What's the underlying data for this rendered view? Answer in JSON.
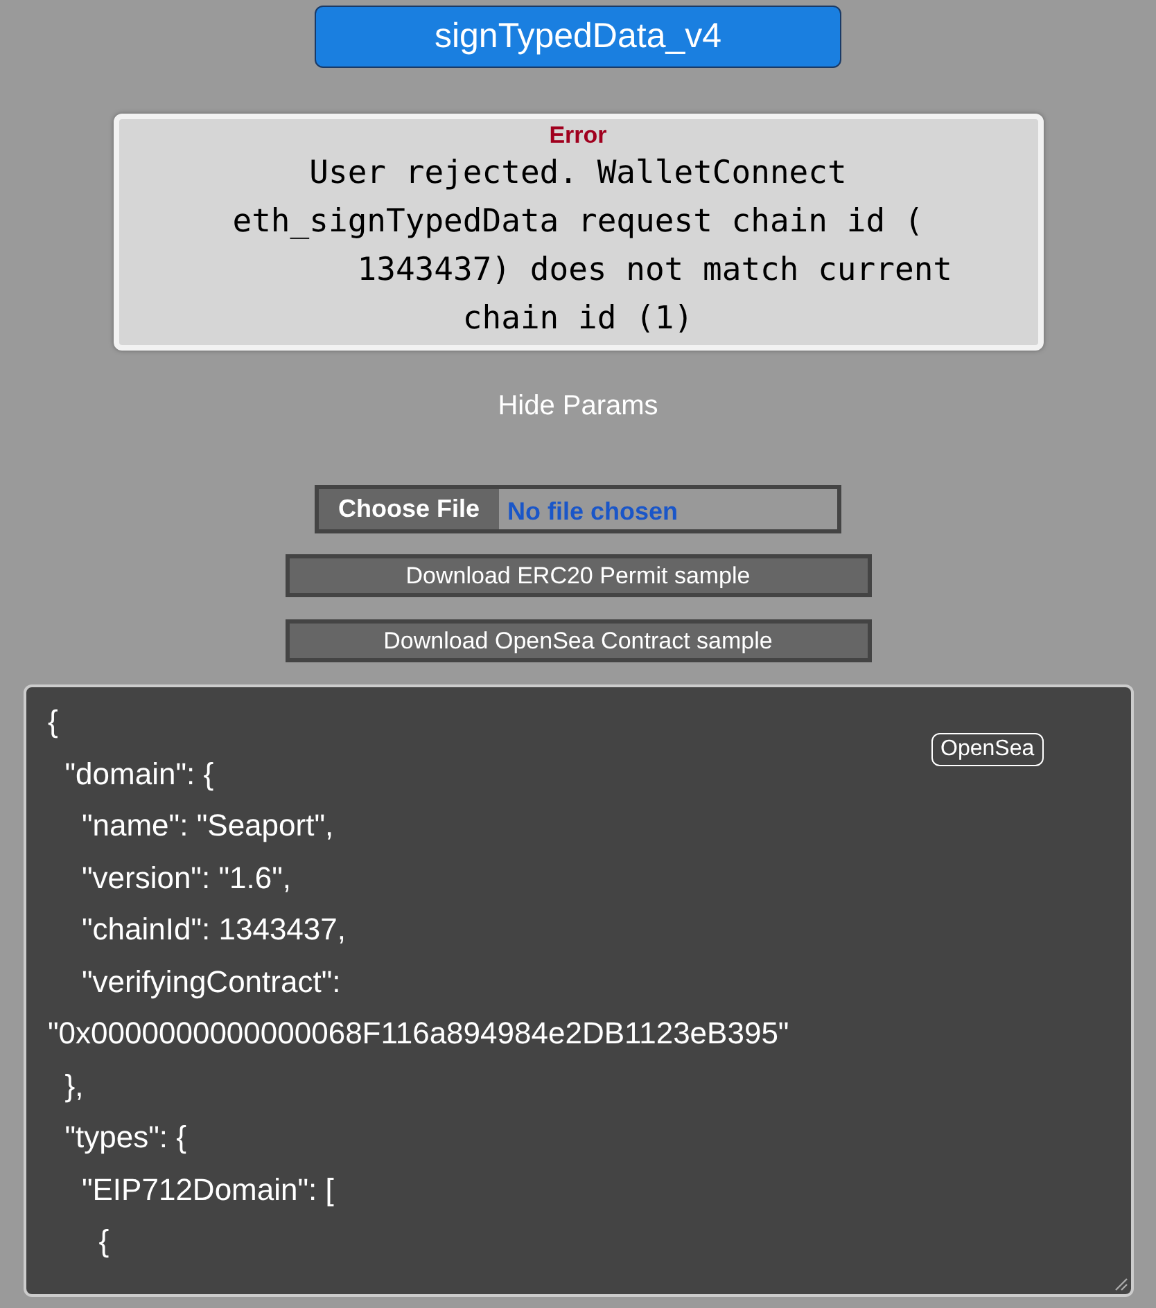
{
  "title_button": "signTypedData_v4",
  "error": {
    "label": "Error",
    "message": "User rejected. WalletConnect\neth_signTypedData request chain id (\n        1343437) does not match current\nchain id (1)"
  },
  "toggle_params": "Hide Params",
  "file_input": {
    "button": "Choose File",
    "status": "No file chosen"
  },
  "buttons": [
    "Download ERC20 Permit sample",
    "Download OpenSea Contract sample"
  ],
  "editor": {
    "badge": "OpenSea",
    "value": "{\n  \"domain\": {\n    \"name\": \"Seaport\",\n    \"version\": \"1.6\",\n    \"chainId\": 1343437,\n    \"verifyingContract\": \"0x0000000000000068F116a894984e2DB1123eB395\"\n  },\n  \"types\": {\n    \"EIP712Domain\": [\n      {"
  }
}
